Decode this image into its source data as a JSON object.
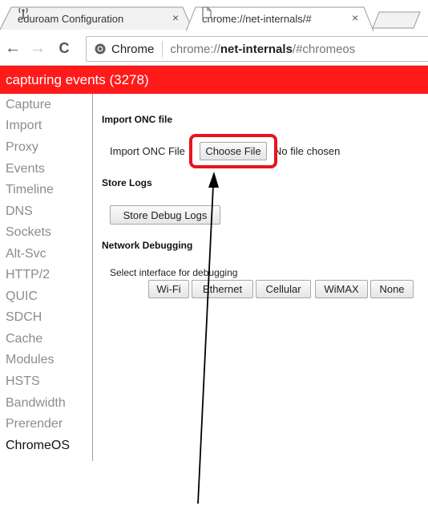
{
  "tabs": [
    {
      "title": "eduroam Configuration",
      "close": "×"
    },
    {
      "title": "chrome://net-internals/#",
      "close": "×"
    }
  ],
  "toolbar": {
    "back": "←",
    "forward": "→",
    "reload": "C",
    "scheme_label": "Chrome",
    "url_prefix": "chrome://",
    "url_host": "net-internals",
    "url_suffix": "/#chromeos"
  },
  "status": {
    "text": "capturing events (3278)"
  },
  "sidebar": {
    "items": [
      "Capture",
      "Import",
      "Proxy",
      "Events",
      "Timeline",
      "DNS",
      "Sockets",
      "Alt-Svc",
      "HTTP/2",
      "QUIC",
      "SDCH",
      "Cache",
      "Modules",
      "HSTS",
      "Bandwidth",
      "Prerender",
      "ChromeOS"
    ],
    "selected": "ChromeOS"
  },
  "import_onc": {
    "heading": "Import ONC file",
    "label": "Import ONC File",
    "choose_label": "Choose File",
    "no_file": "No file chosen"
  },
  "store_logs": {
    "heading": "Store Logs",
    "button": "Store Debug Logs"
  },
  "network_debugging": {
    "heading": "Network Debugging",
    "label": "Select interface for debugging",
    "interfaces": [
      "Wi-Fi",
      "Ethernet",
      "Cellular",
      "WiMAX",
      "None"
    ]
  },
  "annotation": {
    "highlight_color": "#e8141c",
    "arrow_color": "#000000"
  },
  "colors": {
    "status_bar": "#ff1a1a"
  }
}
